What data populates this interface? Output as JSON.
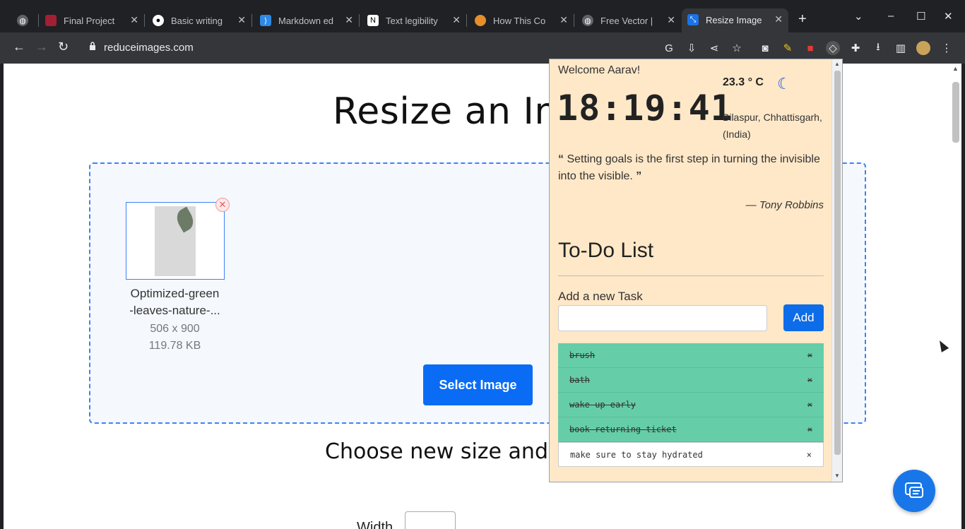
{
  "tabs": [
    {
      "title": "",
      "color": "#5f6368",
      "icon": "globe-icon"
    },
    {
      "title": "Final Project",
      "color": "#a31f34",
      "icon": "shield-icon"
    },
    {
      "title": "Basic writing",
      "color": "#ffffff",
      "icon": "github-icon"
    },
    {
      "title": "Markdown ed",
      "color": "#2e8ae6",
      "icon": "vscode-icon"
    },
    {
      "title": "Text legibility",
      "color": "#ffffff",
      "icon": "notion-icon"
    },
    {
      "title": "How This Co",
      "color": "#e58f2a",
      "icon": "fox-icon"
    },
    {
      "title": "Free Vector |",
      "color": "#5f6368",
      "icon": "globe-icon"
    },
    {
      "title": "Resize Image",
      "color": "#1a73e8",
      "icon": "resize-icon"
    }
  ],
  "omnibox": {
    "url": "reduceimages.com"
  },
  "page": {
    "heading": "Resize an Im",
    "file": {
      "name_line1": "Optimized-green",
      "name_line2": "-leaves-nature-...",
      "dims": "506 x 900",
      "size": "119.78 KB"
    },
    "select_button": "Select Image",
    "subheading": "Choose new size and",
    "width_label": "Width"
  },
  "popup": {
    "welcome": "Welcome Aarav!",
    "clock": "18:19:41",
    "temperature": "23.3 ° C",
    "location": "Bilaspur, Chhattisgarh, (India)",
    "quote": "Setting goals is the first step in turning the invisible into the visible.",
    "author": "— Tony Robbins",
    "todo_title": "To-Do List",
    "add_label": "Add a new Task",
    "add_button": "Add",
    "tasks": [
      {
        "text": "brush",
        "done": true
      },
      {
        "text": "bath",
        "done": true
      },
      {
        "text": "wake up early",
        "done": true
      },
      {
        "text": "book returning ticket",
        "done": true
      },
      {
        "text": "make sure to stay hydrated",
        "done": false
      }
    ],
    "delete_symbol": "×"
  }
}
